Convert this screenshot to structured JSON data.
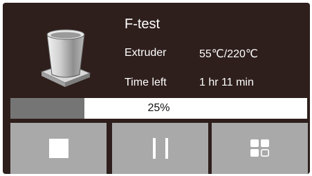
{
  "job": {
    "name": "F-test"
  },
  "info": {
    "extruder_label": "Extruder",
    "extruder_value": "55℃/220℃",
    "time_label": "Time left",
    "time_value": "1 hr 11 min"
  },
  "progress": {
    "value": 0.25,
    "label": "25%"
  },
  "icons": {
    "thumbnail": "cup-model-thumbnail",
    "stop": "stop-icon",
    "pause": "pause-icon",
    "more": "more-options-icon"
  },
  "colors": {
    "background": "#2e1f1c",
    "button": "#a9a9a9",
    "progress_fill": "#757575",
    "progress_track": "#ffffff",
    "text": "#ffffff"
  }
}
